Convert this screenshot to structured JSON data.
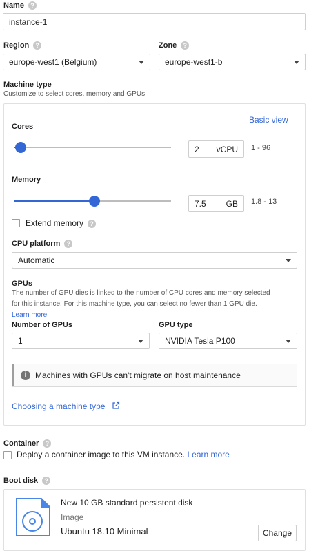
{
  "name": {
    "label": "Name",
    "value": "instance-1"
  },
  "region": {
    "label": "Region",
    "value": "europe-west1 (Belgium)"
  },
  "zone": {
    "label": "Zone",
    "value": "europe-west1-b"
  },
  "machine_type": {
    "label": "Machine type",
    "subtitle": "Customize to select cores, memory and GPUs.",
    "basic_view": "Basic view",
    "cores": {
      "label": "Cores",
      "value": "2",
      "unit": "vCPU",
      "range": "1 - 96",
      "slider_fraction": 0.05
    },
    "memory": {
      "label": "Memory",
      "value": "7.5",
      "unit": "GB",
      "range": "1.8 - 13",
      "slider_fraction": 0.5
    },
    "extend_memory": "Extend memory",
    "cpu_platform": {
      "label": "CPU platform",
      "value": "Automatic"
    },
    "gpus": {
      "label": "GPUs",
      "description_line1": "The number of GPU dies is linked to the number of CPU cores and memory selected",
      "description_line2": "for this instance. For this machine type, you can select no fewer than 1 GPU die.",
      "learn_more": "Learn more",
      "number_label": "Number of GPUs",
      "number_value": "1",
      "type_label": "GPU type",
      "type_value": "NVIDIA Tesla P100",
      "info": "Machines with GPUs can't migrate on host maintenance"
    },
    "choosing_link": "Choosing a machine type"
  },
  "container": {
    "label": "Container",
    "checkbox_text": "Deploy a container image to this VM instance.",
    "learn_more": "Learn more"
  },
  "boot_disk": {
    "label": "Boot disk",
    "title": "New 10 GB standard persistent disk",
    "image_label": "Image",
    "image_value": "Ubuntu 18.10 Minimal",
    "change": "Change"
  },
  "colors": {
    "accent": "#3367d6",
    "border": "#cfcfcf"
  }
}
